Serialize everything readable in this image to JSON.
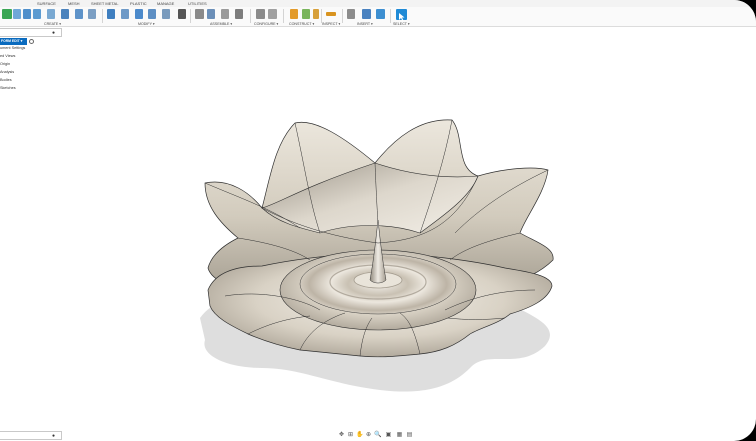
{
  "tabs": [
    "SURFACE",
    "MESH",
    "SHEET METAL",
    "PLASTIC",
    "MANAGE",
    "UTILITIES"
  ],
  "toolbar": {
    "groups": [
      "CREATE ▾",
      "MODIFY ▾",
      "ASSEMBLE ▾",
      "CONFIGURE ▾",
      "CONSTRUCT ▾",
      "INSPECT ▾",
      "INSERT ▾",
      "SELECT ▾"
    ],
    "accent": "#1f8ad6"
  },
  "browser": {
    "document_label": "FORM EDIT ▾",
    "items": [
      "ument Settings",
      "ed Views",
      "Origin",
      "Analysis",
      "Bodies",
      "Sketches"
    ]
  },
  "glyphs": {
    "bullet": "●",
    "pin": "◉"
  },
  "navbar": {
    "icons": [
      "✥",
      "⊞",
      "✋",
      "⊕",
      "🔍",
      "▣",
      "▦",
      "▤"
    ]
  },
  "colors": {
    "surface_light": "#ece7dd",
    "surface_mid": "#cfc7b8",
    "surface_dark": "#8e877a",
    "edge": "#2f2f2f",
    "shadow": "#d9d9d9"
  }
}
